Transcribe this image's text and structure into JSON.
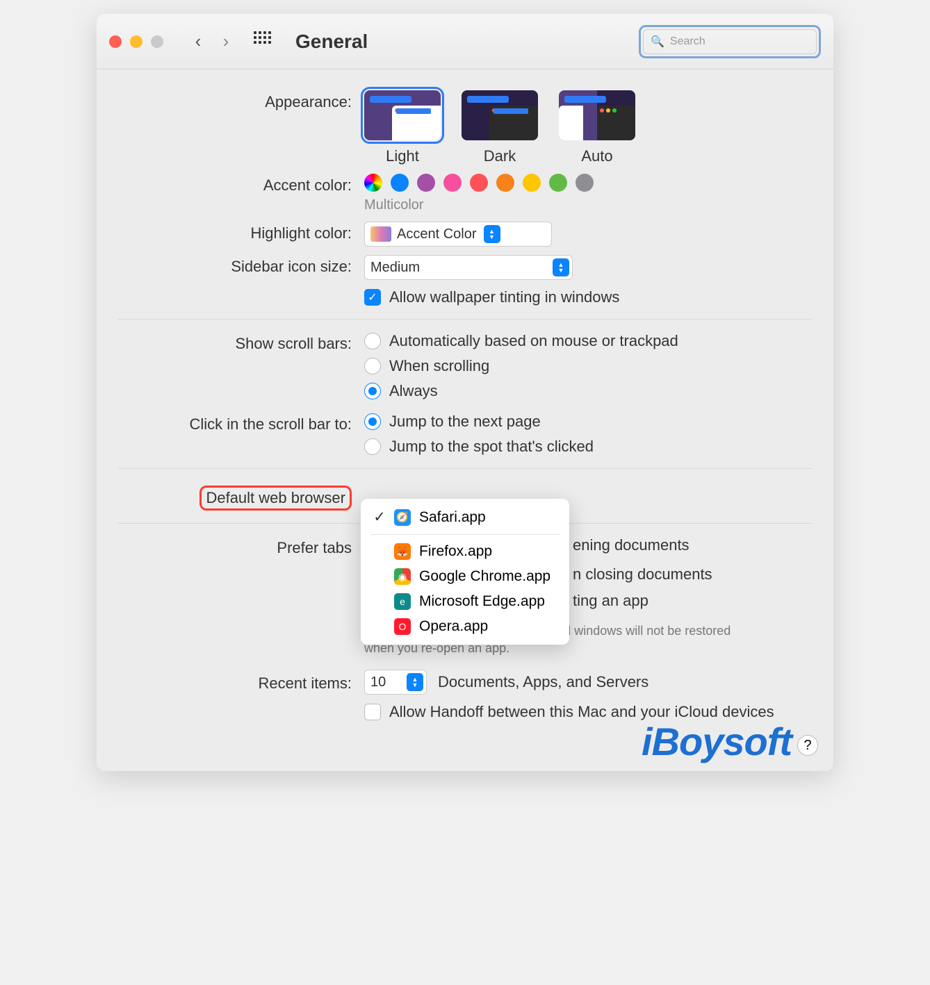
{
  "header": {
    "title": "General",
    "search_placeholder": "Search"
  },
  "appearance": {
    "label": "Appearance:",
    "options": {
      "light": "Light",
      "dark": "Dark",
      "auto": "Auto"
    },
    "selected": "light"
  },
  "accent": {
    "label": "Accent color:",
    "sub": "Multicolor",
    "colors": [
      "multicolor",
      "#0a84ff",
      "#a550a7",
      "#f74f9e",
      "#ff5257",
      "#f7821b",
      "#ffc600",
      "#62ba46",
      "#8e8e93"
    ]
  },
  "highlight": {
    "label": "Highlight color:",
    "value": "Accent Color"
  },
  "sidebar": {
    "label": "Sidebar icon size:",
    "value": "Medium"
  },
  "wallpaper_tint": {
    "label": "Allow wallpaper tinting in windows",
    "checked": true
  },
  "scrollbars": {
    "label": "Show scroll bars:",
    "options": [
      "Automatically based on mouse or trackpad",
      "When scrolling",
      "Always"
    ],
    "selected": 2
  },
  "click_scroll": {
    "label": "Click in the scroll bar to:",
    "options": [
      "Jump to the next page",
      "Jump to the spot that's clicked"
    ],
    "selected": 0
  },
  "default_browser": {
    "label": "Default web browser",
    "menu": [
      {
        "name": "Safari.app",
        "checked": true,
        "color": "#1e90ff"
      },
      {
        "name": "Firefox.app",
        "checked": false,
        "color": "#ff7b00"
      },
      {
        "name": "Google Chrome.app",
        "checked": false,
        "color": "#4285f4"
      },
      {
        "name": "Microsoft Edge.app",
        "checked": false,
        "color": "#0c8a8a"
      },
      {
        "name": "Opera.app",
        "checked": false,
        "color": "#ff1b2d"
      }
    ]
  },
  "prefer_tabs": {
    "label": "Prefer tabs",
    "suffix": "ening documents"
  },
  "closing_docs": {
    "label_fragment": "n closing documents"
  },
  "quitting_app": {
    "label_fragment": "ting an app"
  },
  "restore_hint": "When selected, open documents and windows will not be restored when you re-open an app.",
  "recent": {
    "label": "Recent items:",
    "value": "10",
    "suffix": "Documents, Apps, and Servers"
  },
  "handoff": {
    "label": "Allow Handoff between this Mac and your iCloud devices",
    "checked": false
  },
  "watermark": "iBoysoft"
}
